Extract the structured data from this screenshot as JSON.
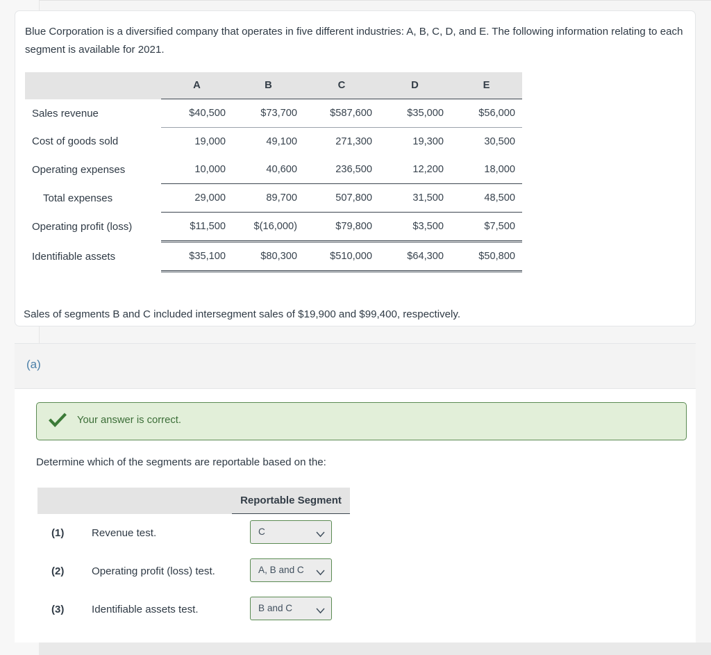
{
  "problem": {
    "intro": "Blue Corporation is a diversified company that operates in five different industries: A, B, C, D, and E. The following information relating to each segment is available for 2021.",
    "footnote": "Sales of segments B and C included intersegment sales of $19,900 and $99,400, respectively."
  },
  "financial_table": {
    "row_header_blank": "",
    "columns": [
      "A",
      "B",
      "C",
      "D",
      "E"
    ],
    "rows": [
      {
        "label": "Sales revenue",
        "values": [
          "$40,500",
          "$73,700",
          "$587,600",
          "$35,000",
          "$56,000"
        ]
      },
      {
        "label": "Cost of goods sold",
        "values": [
          "19,000",
          "49,100",
          "271,300",
          "19,300",
          "30,500"
        ]
      },
      {
        "label": "Operating expenses",
        "values": [
          "10,000",
          "40,600",
          "236,500",
          "12,200",
          "18,000"
        ]
      },
      {
        "label": "Total expenses",
        "values": [
          "29,000",
          "89,700",
          "507,800",
          "31,500",
          "48,500"
        ]
      },
      {
        "label": "Operating profit (loss)",
        "values": [
          "$11,500",
          "$(16,000)",
          "$79,800",
          "$3,500",
          "$7,500"
        ]
      },
      {
        "label": "Identifiable assets",
        "values": [
          "$35,100",
          "$80,300",
          "$510,000",
          "$64,300",
          "$50,800"
        ]
      }
    ]
  },
  "part_a": {
    "label": "(a)",
    "feedback": {
      "icon": "checkmark-icon",
      "message": "Your answer is correct.",
      "background_color": "#e2efd9",
      "border_color": "#5a8a52",
      "text_color": "#3c6e38"
    },
    "prompt": "Determine which of the segments are reportable based on the:",
    "answer_table": {
      "header_blank": "",
      "header_title": "Reportable Segment",
      "rows": [
        {
          "number": "(1)",
          "test": "Revenue test.",
          "selected": "C"
        },
        {
          "number": "(2)",
          "test": "Operating profit (loss) test.",
          "selected": "A, B and C"
        },
        {
          "number": "(3)",
          "test": "Identifiable assets test.",
          "selected": "B and C"
        }
      ]
    }
  }
}
